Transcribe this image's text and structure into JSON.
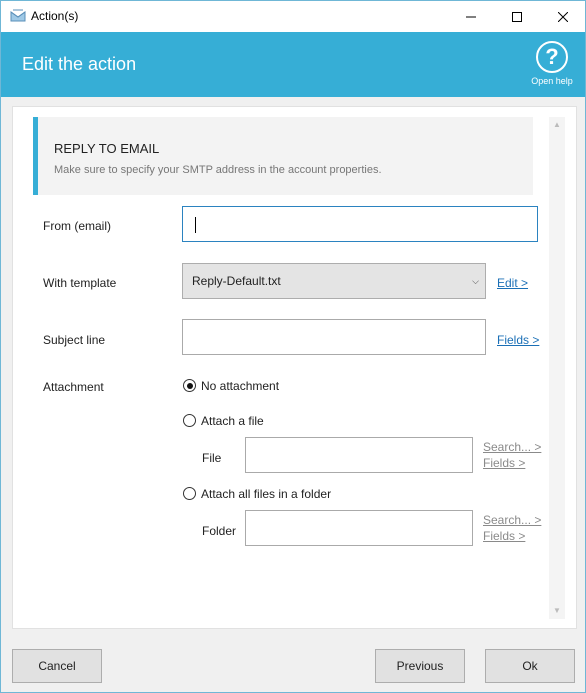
{
  "window": {
    "title": "Action(s)"
  },
  "header": {
    "title": "Edit the action",
    "help_label": "Open help"
  },
  "info": {
    "title": "REPLY TO EMAIL",
    "subtitle": "Make sure to specify your SMTP address in the account properties."
  },
  "form": {
    "from_label": "From (email)",
    "from_value": "",
    "template_label": "With template",
    "template_value": "Reply-Default.txt",
    "template_edit_link": "Edit >",
    "subject_label": "Subject line",
    "subject_value": "",
    "subject_fields_link": "Fields >",
    "attachment_label": "Attachment",
    "attachment_options": [
      {
        "label": "No attachment",
        "checked": true
      },
      {
        "label": "Attach a file",
        "checked": false
      },
      {
        "label": "Attach all files in a folder",
        "checked": false
      }
    ],
    "file_label": "File",
    "file_search_link": "Search... >",
    "file_fields_link": "Fields >",
    "folder_label": "Folder",
    "folder_search_link": "Search... >",
    "folder_fields_link": "Fields >"
  },
  "footer": {
    "cancel": "Cancel",
    "previous": "Previous",
    "ok": "Ok"
  },
  "colors": {
    "accent": "#36aed6",
    "link": "#1a6fb6"
  }
}
